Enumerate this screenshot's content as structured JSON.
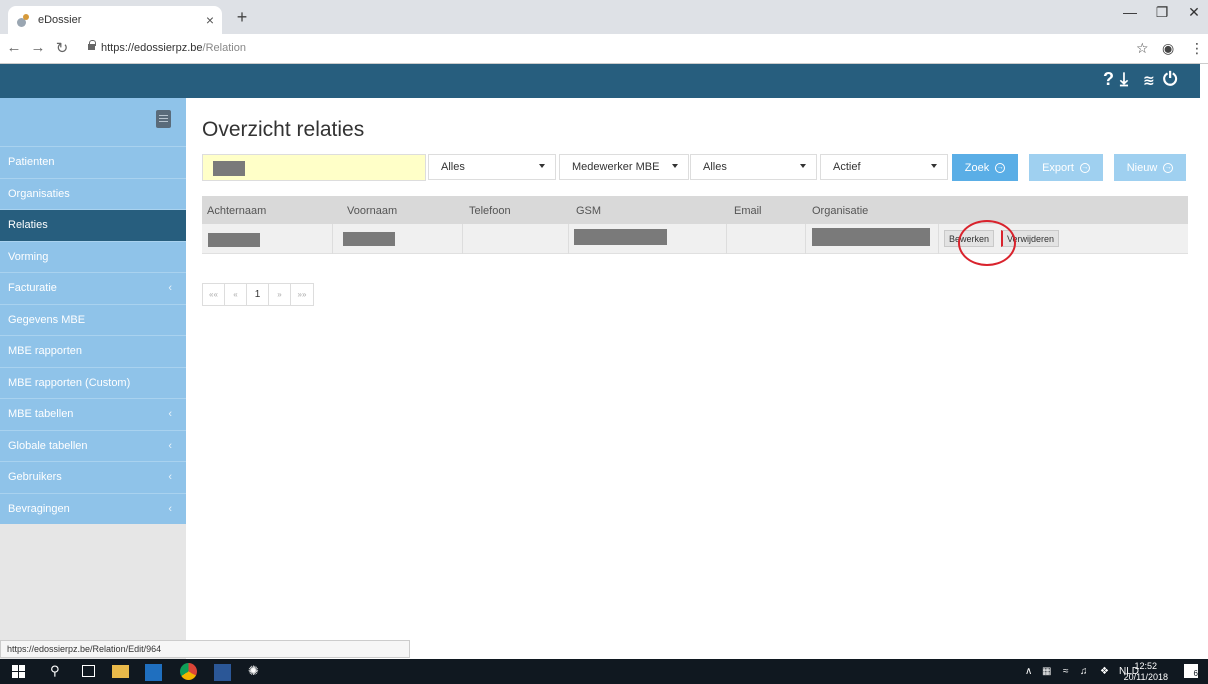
{
  "browser": {
    "tab_title": "eDossier",
    "tab_close": "×",
    "new_tab": "+",
    "url_scheme": "https://edossierpz.be",
    "url_path": "/Relation",
    "status_url": "https://edossierpz.be/Relation/Edit/964"
  },
  "header": {
    "help_icon": "?",
    "download_icon": "⤓",
    "database_icon": "≋",
    "power_icon": "⏻"
  },
  "sidebar": {
    "items": [
      {
        "label": "Patienten",
        "active": false,
        "has_children": false
      },
      {
        "label": "Organisaties",
        "active": false,
        "has_children": false
      },
      {
        "label": "Relaties",
        "active": true,
        "has_children": false
      },
      {
        "label": "Vorming",
        "active": false,
        "has_children": false
      },
      {
        "label": "Facturatie",
        "active": false,
        "has_children": true
      },
      {
        "label": "Gegevens MBE",
        "active": false,
        "has_children": false
      },
      {
        "label": "MBE rapporten",
        "active": false,
        "has_children": false
      },
      {
        "label": "MBE rapporten (Custom)",
        "active": false,
        "has_children": false
      },
      {
        "label": "MBE tabellen",
        "active": false,
        "has_children": true
      },
      {
        "label": "Globale tabellen",
        "active": false,
        "has_children": true
      },
      {
        "label": "Gebruikers",
        "active": false,
        "has_children": true
      },
      {
        "label": "Bevragingen",
        "active": false,
        "has_children": true
      }
    ]
  },
  "main": {
    "title": "Overzicht relaties",
    "filters": {
      "type": "Alles",
      "role": "Medewerker MBE",
      "scope": "Alles",
      "status": "Actief"
    },
    "buttons": {
      "search": "Zoek",
      "export": "Export",
      "new": "Nieuw"
    },
    "table": {
      "headers": [
        "Achternaam",
        "Voornaam",
        "Telefoon",
        "GSM",
        "Email",
        "Organisatie"
      ],
      "row_actions": {
        "edit": "Bewerken",
        "delete": "Verwijderen"
      }
    },
    "pagination": [
      "««",
      "«",
      "1",
      "»",
      "»»"
    ]
  },
  "taskbar": {
    "language": "NLD",
    "time": "12:52",
    "date": "20/11/2018",
    "notification_count": "6"
  },
  "colors": {
    "header": "#275e7e",
    "sidebar": "#8fc3e9",
    "button": "#5aaee6",
    "highlight_circle": "#d9232d"
  }
}
